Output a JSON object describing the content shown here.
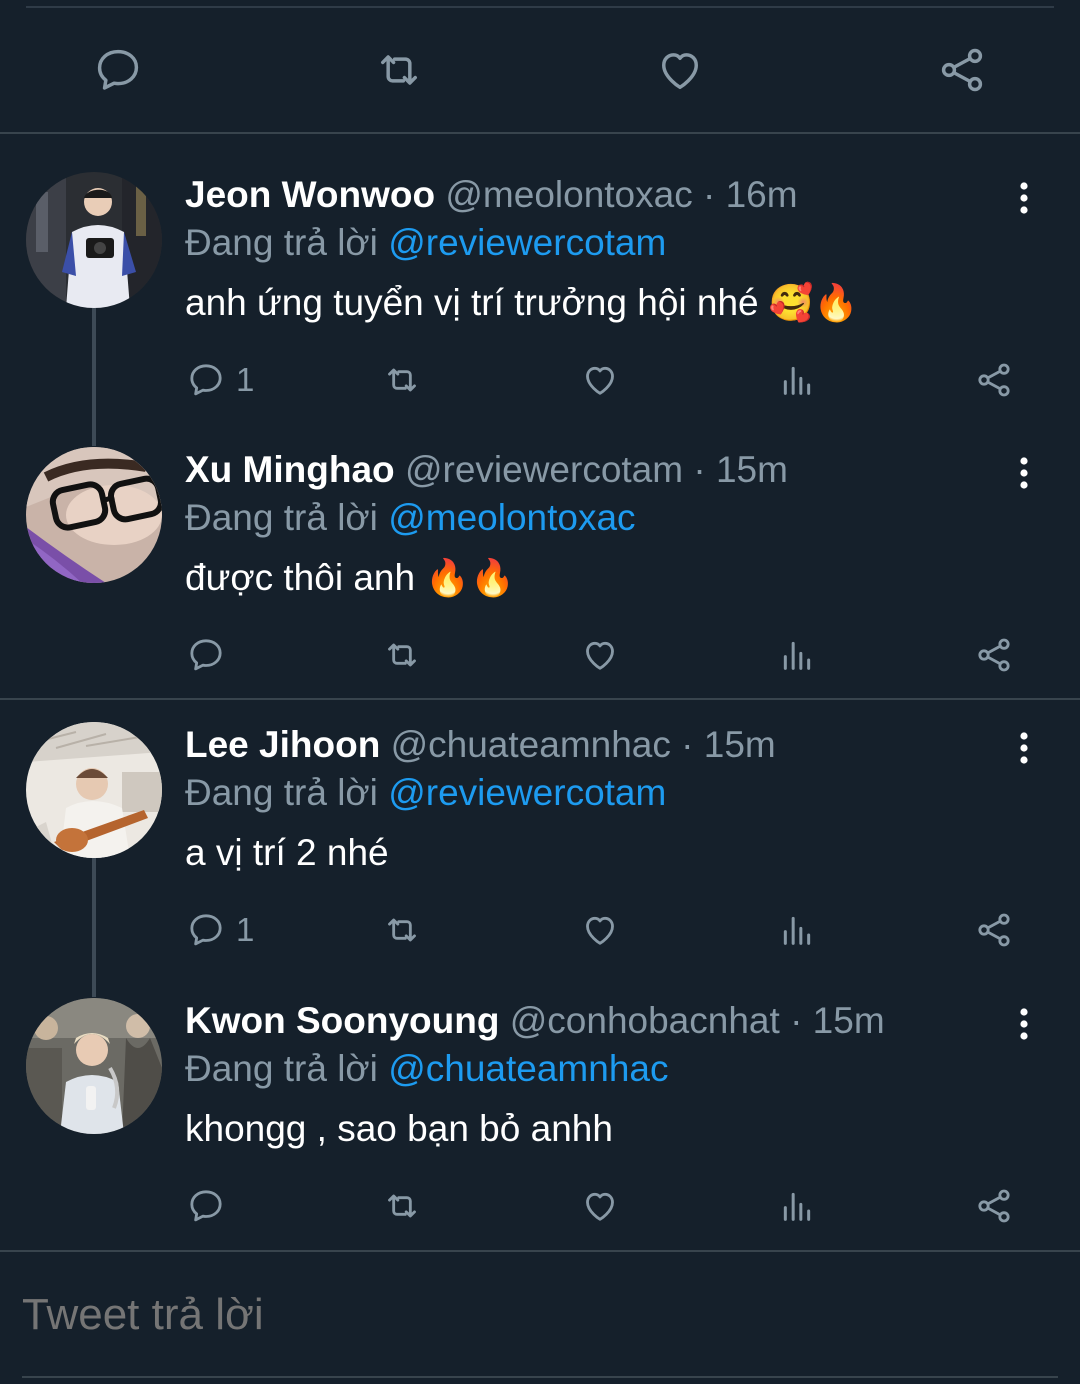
{
  "colors": {
    "background": "#15202b",
    "divider": "#38444d",
    "muted_text": "#8899a6",
    "mention": "#1d9bf0",
    "icon": "#8899a6"
  },
  "main_actions": {
    "icons": [
      "reply-icon",
      "retweet-icon",
      "like-icon",
      "share-icon"
    ]
  },
  "tweets": [
    {
      "name": "Jeon Wonwoo",
      "handle": "@meolontoxac",
      "dot": "·",
      "time": "16m",
      "replying_prefix": "Đang trả lời",
      "replying_to": "@reviewercotam",
      "text": "anh ứng tuyển vị trí trưởng hội nhé",
      "emojis": [
        "🥰",
        "🔥"
      ],
      "reply_count": "1",
      "avatar_icon": "person-photo-icon"
    },
    {
      "name": "Xu Minghao",
      "handle": "@reviewercotam",
      "dot": "·",
      "time": "15m",
      "replying_prefix": "Đang trả lời",
      "replying_to": "@meolontoxac",
      "text": "được thôi anh",
      "emojis": [
        "🔥",
        "🔥"
      ],
      "reply_count": "",
      "avatar_icon": "glasses-photo-icon"
    },
    {
      "name": "Lee Jihoon",
      "handle": "@chuateamnhac",
      "dot": "·",
      "time": "15m",
      "replying_prefix": "Đang trả lời",
      "replying_to": "@reviewercotam",
      "text": "a vị trí 2 nhé",
      "emojis": [],
      "reply_count": "1",
      "avatar_icon": "guitar-photo-icon"
    },
    {
      "name": "Kwon Soonyoung",
      "handle": "@conhobacnhat",
      "dot": "·",
      "time": "15m",
      "replying_prefix": "Đang trả lời",
      "replying_to": "@chuateamnhac",
      "text": "khongg , sao bạn bỏ anhh",
      "emojis": [],
      "reply_count": "",
      "avatar_icon": "crowd-photo-icon"
    }
  ],
  "reply_box": {
    "placeholder": "Tweet trả lời"
  }
}
